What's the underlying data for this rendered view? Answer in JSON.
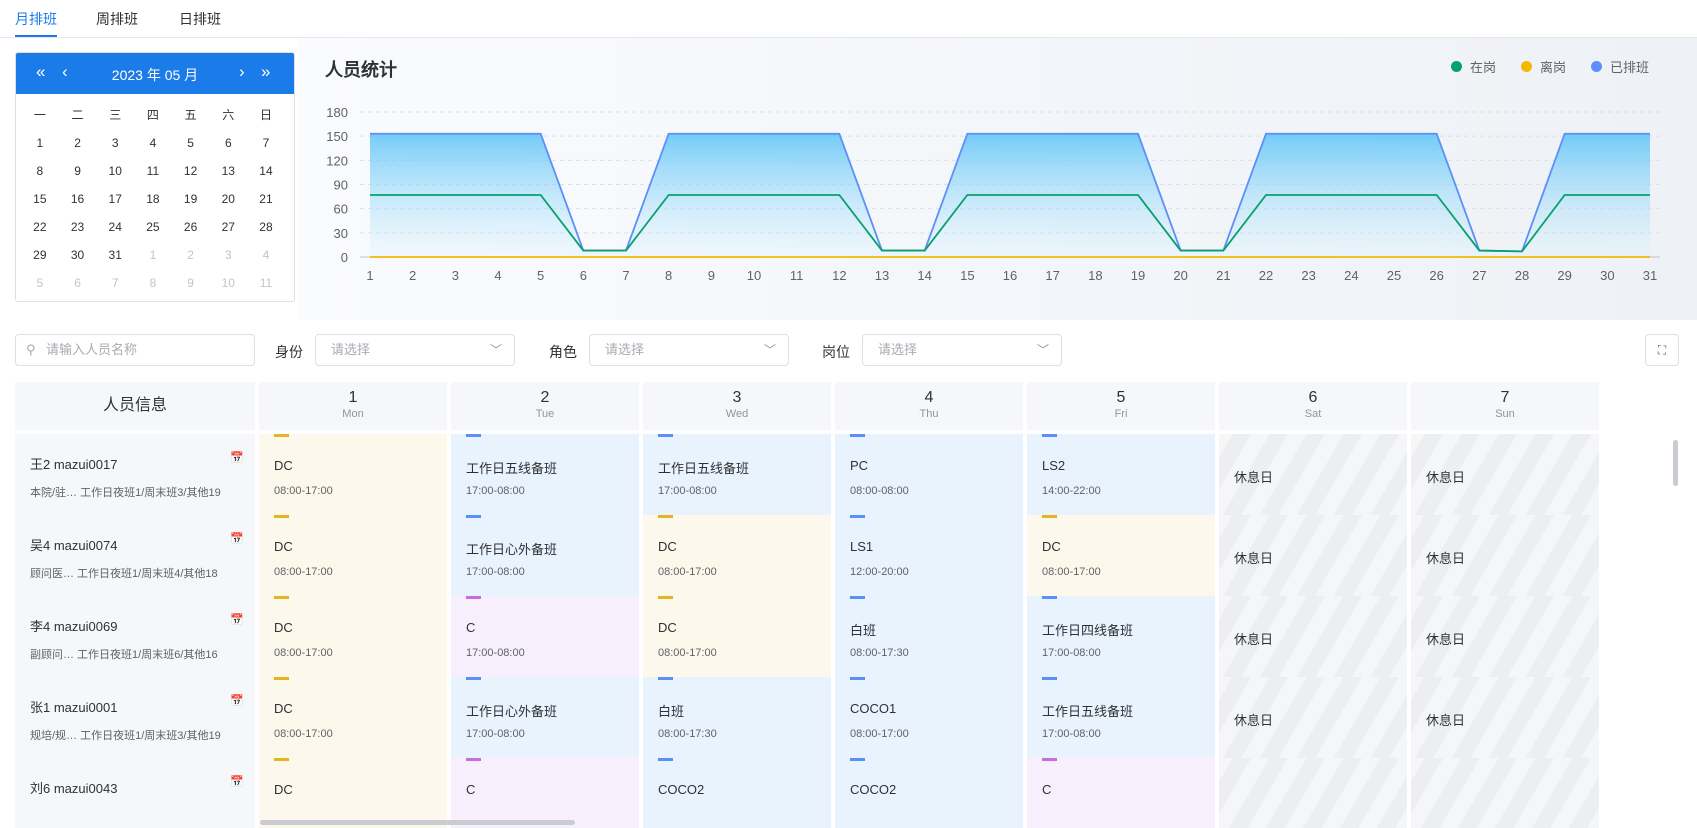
{
  "tabs": [
    {
      "label": "月排班",
      "active": true
    },
    {
      "label": "周排班",
      "active": false
    },
    {
      "label": "日排班",
      "active": false
    }
  ],
  "calendar": {
    "title": "2023 年 05 月",
    "weekdays": [
      "一",
      "二",
      "三",
      "四",
      "五",
      "六",
      "日"
    ],
    "weeks": [
      [
        {
          "d": "1",
          "o": false
        },
        {
          "d": "2",
          "o": false
        },
        {
          "d": "3",
          "o": false
        },
        {
          "d": "4",
          "o": false
        },
        {
          "d": "5",
          "o": false
        },
        {
          "d": "6",
          "o": false
        },
        {
          "d": "7",
          "o": false
        }
      ],
      [
        {
          "d": "8",
          "o": false
        },
        {
          "d": "9",
          "o": false
        },
        {
          "d": "10",
          "o": false
        },
        {
          "d": "11",
          "o": false
        },
        {
          "d": "12",
          "o": false
        },
        {
          "d": "13",
          "o": false
        },
        {
          "d": "14",
          "o": false
        }
      ],
      [
        {
          "d": "15",
          "o": false
        },
        {
          "d": "16",
          "o": false
        },
        {
          "d": "17",
          "o": false
        },
        {
          "d": "18",
          "o": false
        },
        {
          "d": "19",
          "o": false
        },
        {
          "d": "20",
          "o": false
        },
        {
          "d": "21",
          "o": false
        }
      ],
      [
        {
          "d": "22",
          "o": false
        },
        {
          "d": "23",
          "o": false
        },
        {
          "d": "24",
          "o": false
        },
        {
          "d": "25",
          "o": false
        },
        {
          "d": "26",
          "o": false
        },
        {
          "d": "27",
          "o": false
        },
        {
          "d": "28",
          "o": false
        }
      ],
      [
        {
          "d": "29",
          "o": false
        },
        {
          "d": "30",
          "o": false
        },
        {
          "d": "31",
          "o": false
        },
        {
          "d": "1",
          "o": true
        },
        {
          "d": "2",
          "o": true
        },
        {
          "d": "3",
          "o": true
        },
        {
          "d": "4",
          "o": true
        }
      ],
      [
        {
          "d": "5",
          "o": true
        },
        {
          "d": "6",
          "o": true
        },
        {
          "d": "7",
          "o": true
        },
        {
          "d": "8",
          "o": true
        },
        {
          "d": "9",
          "o": true
        },
        {
          "d": "10",
          "o": true
        },
        {
          "d": "11",
          "o": true
        }
      ]
    ]
  },
  "stats": {
    "title": "人员统计",
    "legend": [
      {
        "name": "在岗",
        "color": "#07a16e"
      },
      {
        "name": "离岗",
        "color": "#f5b800"
      },
      {
        "name": "已排班",
        "color": "#5b8ff9"
      }
    ]
  },
  "chart_data": {
    "type": "line",
    "x": [
      1,
      2,
      3,
      4,
      5,
      6,
      7,
      8,
      9,
      10,
      11,
      12,
      13,
      14,
      15,
      16,
      17,
      18,
      19,
      20,
      21,
      22,
      23,
      24,
      25,
      26,
      27,
      28,
      29,
      30,
      31
    ],
    "ylim": [
      0,
      180
    ],
    "yticks": [
      0,
      30,
      60,
      90,
      120,
      150,
      180
    ],
    "series": [
      {
        "name": "已排班",
        "color": "#5b8ff9",
        "fill": true,
        "values": [
          153,
          153,
          153,
          153,
          153,
          8,
          8,
          153,
          153,
          153,
          153,
          153,
          8,
          8,
          153,
          153,
          153,
          153,
          153,
          8,
          8,
          153,
          153,
          153,
          153,
          153,
          8,
          7,
          153,
          153,
          153
        ]
      },
      {
        "name": "在岗",
        "color": "#07a16e",
        "fill": false,
        "values": [
          77,
          77,
          77,
          77,
          77,
          8,
          8,
          77,
          77,
          77,
          77,
          77,
          8,
          8,
          77,
          77,
          77,
          77,
          77,
          8,
          8,
          77,
          77,
          77,
          77,
          77,
          8,
          7,
          77,
          77,
          77
        ]
      },
      {
        "name": "离岗",
        "color": "#f5b800",
        "fill": false,
        "values": [
          0,
          0,
          0,
          0,
          0,
          0,
          0,
          0,
          0,
          0,
          0,
          0,
          0,
          0,
          0,
          0,
          0,
          0,
          0,
          0,
          0,
          0,
          0,
          0,
          0,
          0,
          0,
          0,
          0,
          0,
          0
        ]
      }
    ],
    "grid": true,
    "legend_position": "top-right"
  },
  "filters": {
    "search_placeholder": "请输入人员名称",
    "identity_label": "身份",
    "identity_placeholder": "请选择",
    "role_label": "角色",
    "role_placeholder": "请选择",
    "post_label": "岗位",
    "post_placeholder": "请选择"
  },
  "table": {
    "info_header": "人员信息",
    "days": [
      {
        "d": "1",
        "w": "Mon"
      },
      {
        "d": "2",
        "w": "Tue"
      },
      {
        "d": "3",
        "w": "Wed"
      },
      {
        "d": "4",
        "w": "Thu"
      },
      {
        "d": "5",
        "w": "Fri"
      },
      {
        "d": "6",
        "w": "Sat"
      },
      {
        "d": "7",
        "w": "Sun"
      }
    ],
    "rows": [
      {
        "name": "王2 mazui0017",
        "sub": "本院/驻…  工作日夜班1/周末班3/其他19",
        "cells": [
          {
            "c": "y",
            "bar": "#e6b422",
            "n": "DC",
            "t": "08:00-17:00"
          },
          {
            "c": "b",
            "bar": "#5b8ff9",
            "n": "工作日五线备班",
            "t": "17:00-08:00"
          },
          {
            "c": "b",
            "bar": "#5b8ff9",
            "n": "工作日五线备班",
            "t": "17:00-08:00"
          },
          {
            "c": "b",
            "bar": "#5b8ff9",
            "n": "PC",
            "t": "08:00-08:00"
          },
          {
            "c": "b",
            "bar": "#5b8ff9",
            "n": "LS2",
            "t": "14:00-22:00"
          },
          {
            "c": "rest",
            "n": "休息日",
            "t": ""
          },
          {
            "c": "rest",
            "n": "休息日",
            "t": ""
          }
        ]
      },
      {
        "name": "吴4 mazui0074",
        "sub": "顾问医…  工作日夜班1/周末班4/其他18",
        "cells": [
          {
            "c": "y",
            "bar": "#e6b422",
            "n": "DC",
            "t": "08:00-17:00"
          },
          {
            "c": "b",
            "bar": "#5b8ff9",
            "n": "工作日心外备班",
            "t": "17:00-08:00"
          },
          {
            "c": "y",
            "bar": "#e6b422",
            "n": "DC",
            "t": "08:00-17:00"
          },
          {
            "c": "b",
            "bar": "#5b8ff9",
            "n": "LS1",
            "t": "12:00-20:00"
          },
          {
            "c": "y",
            "bar": "#e6b422",
            "n": "DC",
            "t": "08:00-17:00"
          },
          {
            "c": "rest",
            "n": "休息日",
            "t": ""
          },
          {
            "c": "rest",
            "n": "休息日",
            "t": ""
          }
        ]
      },
      {
        "name": "李4 mazui0069",
        "sub": "副顾问…  工作日夜班1/周末班6/其他16",
        "cells": [
          {
            "c": "y",
            "bar": "#e6b422",
            "n": "DC",
            "t": "08:00-17:00"
          },
          {
            "c": "p",
            "bar": "#c86be0",
            "n": "C",
            "t": "17:00-08:00"
          },
          {
            "c": "y",
            "bar": "#e6b422",
            "n": "DC",
            "t": "08:00-17:00"
          },
          {
            "c": "b",
            "bar": "#5b8ff9",
            "n": "白班",
            "t": "08:00-17:30"
          },
          {
            "c": "b",
            "bar": "#5b8ff9",
            "n": "工作日四线备班",
            "t": "17:00-08:00"
          },
          {
            "c": "rest",
            "n": "休息日",
            "t": ""
          },
          {
            "c": "rest",
            "n": "休息日",
            "t": ""
          }
        ]
      },
      {
        "name": "张1 mazui0001",
        "sub": "规培/规…  工作日夜班1/周末班3/其他19",
        "cells": [
          {
            "c": "y",
            "bar": "#e6b422",
            "n": "DC",
            "t": "08:00-17:00"
          },
          {
            "c": "b",
            "bar": "#5b8ff9",
            "n": "工作日心外备班",
            "t": "17:00-08:00"
          },
          {
            "c": "b",
            "bar": "#5b8ff9",
            "n": "白班",
            "t": "08:00-17:30"
          },
          {
            "c": "b",
            "bar": "#5b8ff9",
            "n": "COCO1",
            "t": "08:00-17:00"
          },
          {
            "c": "b",
            "bar": "#5b8ff9",
            "n": "工作日五线备班",
            "t": "17:00-08:00"
          },
          {
            "c": "rest",
            "n": "休息日",
            "t": ""
          },
          {
            "c": "rest",
            "n": "休息日",
            "t": ""
          }
        ]
      },
      {
        "name": "刘6 mazui0043",
        "sub": "",
        "cells": [
          {
            "c": "y",
            "bar": "#e6b422",
            "n": "DC",
            "t": ""
          },
          {
            "c": "p",
            "bar": "#c86be0",
            "n": "C",
            "t": ""
          },
          {
            "c": "b",
            "bar": "#5b8ff9",
            "n": "COCO2",
            "t": ""
          },
          {
            "c": "b",
            "bar": "#5b8ff9",
            "n": "COCO2",
            "t": ""
          },
          {
            "c": "p",
            "bar": "#c86be0",
            "n": "C",
            "t": ""
          },
          {
            "c": "rest",
            "n": "",
            "t": ""
          },
          {
            "c": "rest",
            "n": "",
            "t": ""
          }
        ]
      }
    ]
  }
}
